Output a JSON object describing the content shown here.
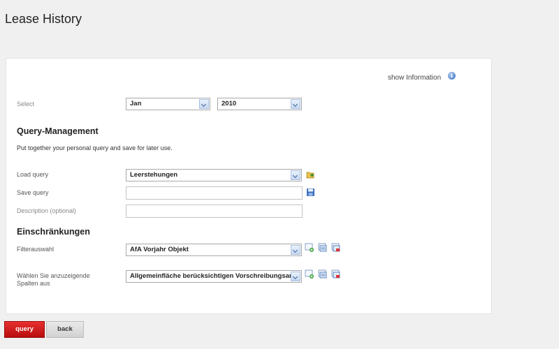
{
  "page": {
    "title": "Lease History"
  },
  "info": {
    "label": "show Information",
    "icon": "info-icon"
  },
  "select_row": {
    "label": "Select",
    "month": "Jan",
    "year": "2010"
  },
  "query_management": {
    "heading": "Query-Management",
    "description": "Put together your personal query and save for later use.",
    "load_label": "Load query",
    "load_value": "Leerstehungen",
    "load_icon": "open-folder-icon",
    "save_label": "Save query",
    "save_value": "",
    "save_icon": "save-disk-icon",
    "description_label": "Description (optional)",
    "description_value": ""
  },
  "restrictions": {
    "heading": "Einschränkungen",
    "filter_label": "Filterauswahl",
    "filter_value": "AfA Vorjahr Objekt",
    "columns_label_line1": "Wählen Sie anzuzeigende",
    "columns_label_line2": "Spalten aus",
    "columns_value": "Allgemeinfläche berücksichtigen Vorschreibungsart",
    "icons": [
      "add-icon",
      "edit-icon",
      "delete-icon"
    ]
  },
  "buttons": {
    "query": "query",
    "back": "back"
  },
  "colors": {
    "primary_button": "#cc1111",
    "secondary_button": "#dcdcdc",
    "panel_bg": "#ffffff",
    "page_bg": "#f0f0f0"
  }
}
